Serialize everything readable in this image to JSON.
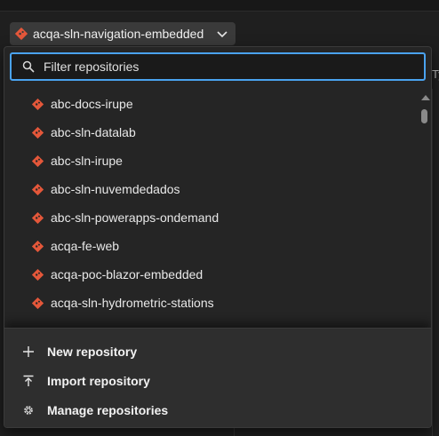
{
  "repo_picker": {
    "current_repo": "acqa-sln-navigation-embedded"
  },
  "search": {
    "placeholder": "Filter repositories",
    "value": ""
  },
  "repositories": [
    {
      "name": "abc-docs-irupe"
    },
    {
      "name": "abc-sln-datalab"
    },
    {
      "name": "abc-sln-irupe"
    },
    {
      "name": "abc-sln-nuvemdedados"
    },
    {
      "name": "abc-sln-powerapps-ondemand"
    },
    {
      "name": "acqa-fe-web"
    },
    {
      "name": "acqa-poc-blazor-embedded"
    },
    {
      "name": "acqa-sln-hydrometric-stations"
    }
  ],
  "actions": {
    "new_repository": "New repository",
    "import_repository": "Import repository",
    "manage_repositories": "Manage repositories"
  },
  "background": {
    "right_hint": "Ty"
  },
  "colors": {
    "git_icon": "#e4573a",
    "focus_border": "#4aa3f0",
    "panel": "#252525",
    "footer": "#2e2e2e"
  }
}
